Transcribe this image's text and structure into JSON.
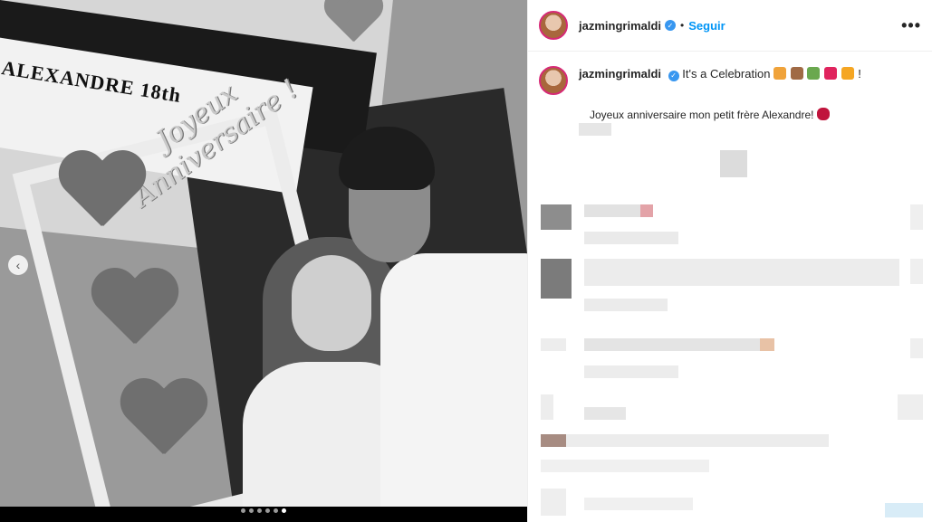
{
  "media": {
    "sign_text": "ALEXANDRE 18th",
    "frame_text_line1": "Joyeux",
    "frame_text_line2": "Anniversaire !",
    "carousel": {
      "total": 6,
      "active_index": 5
    }
  },
  "header": {
    "username": "jazmingrimaldi",
    "separator": "•",
    "follow_label": "Seguir",
    "more_label": "•••"
  },
  "caption": {
    "username": "jazmingrimaldi",
    "line1": "It's a Celebration",
    "line1_suffix": "!",
    "line2": "Joyeux anniversaire mon petit frère Alexandre!",
    "emojis": [
      "party-popper",
      "cake",
      "champagne",
      "red-heart",
      "gift"
    ],
    "line2_emoji": "kiss-lips"
  },
  "colors": {
    "accent_blue": "#0095f6",
    "verified_blue": "#3897f0",
    "story_ring": "#d62976"
  }
}
